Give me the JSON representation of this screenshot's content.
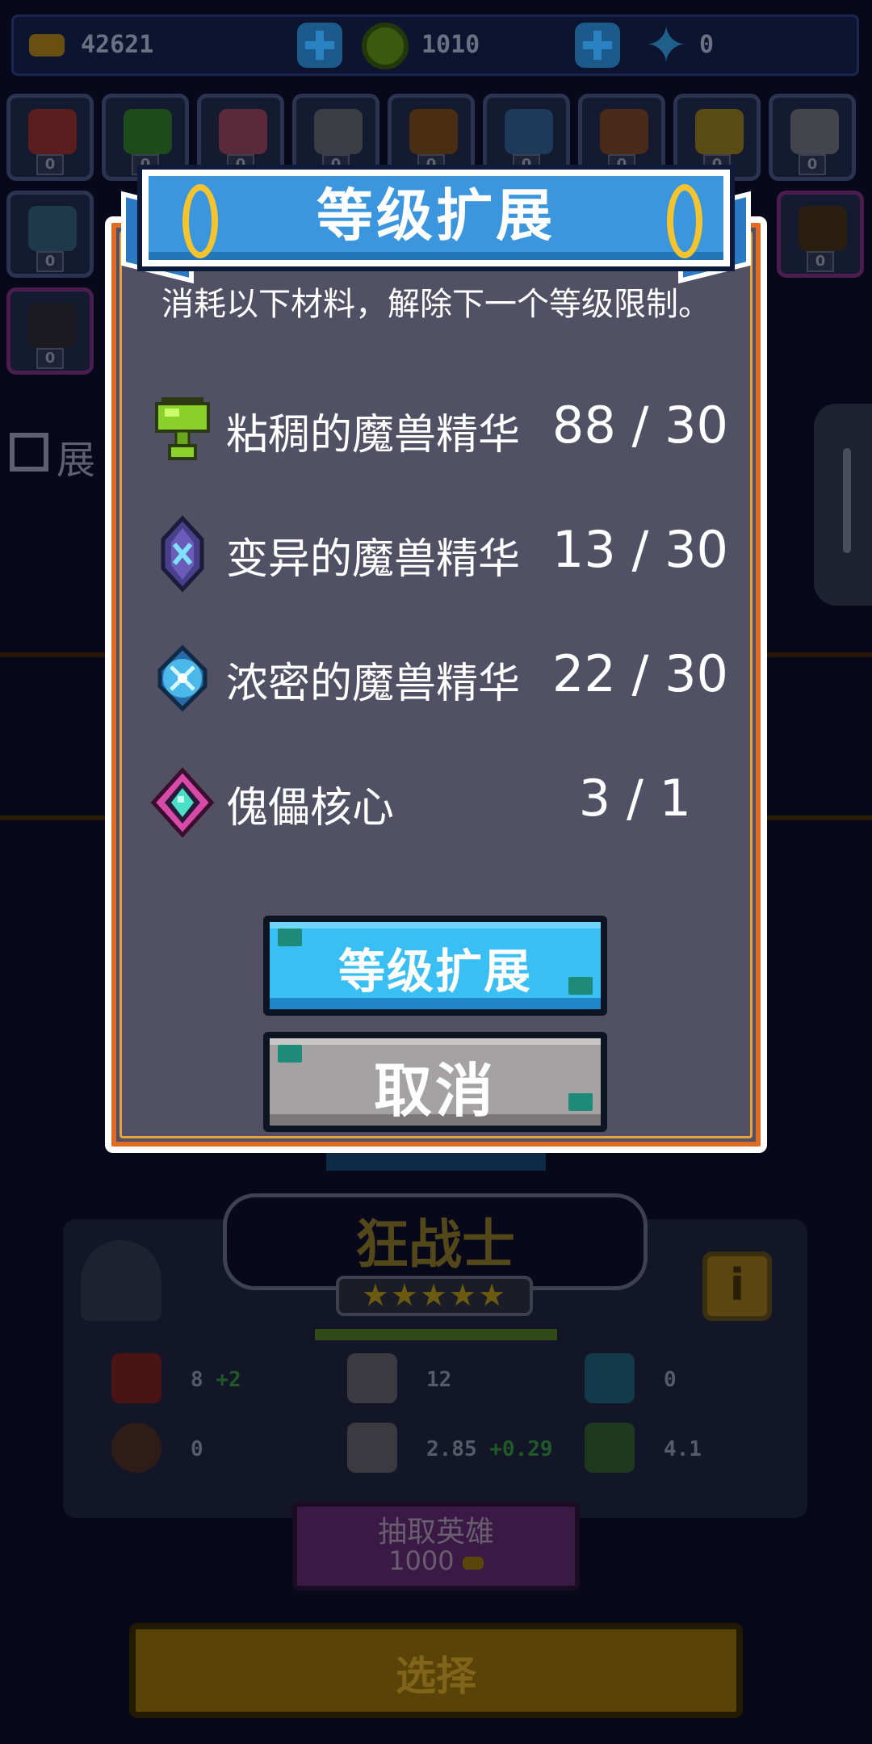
{
  "topbar": {
    "gold": "42621",
    "gems": "1010",
    "stars": "0"
  },
  "hero_slots_level": "0",
  "side_label": "展",
  "dialog": {
    "title": "等级扩展",
    "description": "消耗以下材料，解除下一个等级限制。",
    "materials": [
      {
        "name": "粘稠的魔兽精华",
        "count": "88 / 30",
        "icon": "sticky-essence-icon"
      },
      {
        "name": "变异的魔兽精华",
        "count": "13 / 30",
        "icon": "mutant-essence-icon"
      },
      {
        "name": "浓密的魔兽精华",
        "count": "22 / 30",
        "icon": "dense-essence-icon"
      },
      {
        "name": "傀儡核心",
        "count": "3 / 1",
        "icon": "golem-core-icon"
      }
    ],
    "confirm_label": "等级扩展",
    "cancel_label": "取消"
  },
  "hero": {
    "name": "狂战士",
    "stars": "★★★★★",
    "stats": {
      "hp": "8",
      "hp_bonus": "+2",
      "attack": "12",
      "shield": "0",
      "armor": "0",
      "attack_speed": "2.85",
      "attack_speed_bonus": "+0.29",
      "move_speed": "4.1"
    }
  },
  "draw": {
    "title": "抽取英雄",
    "cost": "1000"
  },
  "select_label": "选择",
  "colors": {
    "dialog_bg": "#525064",
    "banner_blue": "#3b96dd",
    "confirm_blue": "#39bff3",
    "cancel_gray": "#a5a2a3",
    "border_orange": "#e06c24"
  }
}
